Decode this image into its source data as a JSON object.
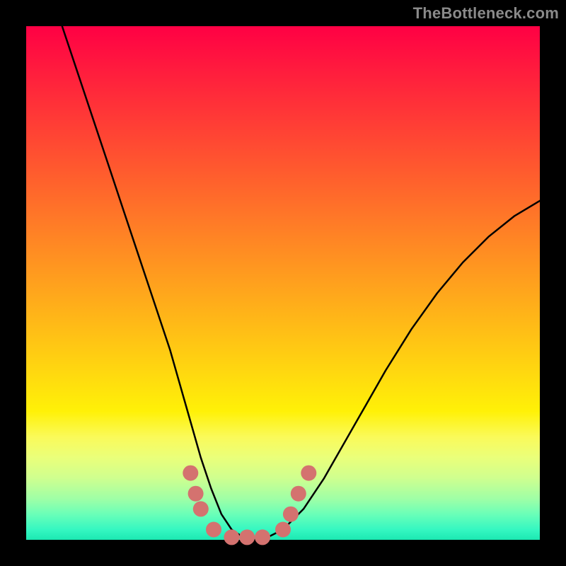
{
  "watermark": "TheBottleneck.com",
  "chart_data": {
    "type": "line",
    "title": "",
    "xlabel": "",
    "ylabel": "",
    "xlim": [
      0,
      100
    ],
    "ylim": [
      0,
      100
    ],
    "grid": false,
    "legend": false,
    "series": [
      {
        "name": "bottleneck-curve",
        "color": "#000000",
        "x": [
          7,
          10,
          13,
          16,
          19,
          22,
          25,
          28,
          30,
          32,
          34,
          36,
          38,
          40,
          43,
          46,
          50,
          54,
          58,
          62,
          66,
          70,
          75,
          80,
          85,
          90,
          95,
          100
        ],
        "y": [
          100,
          91,
          82,
          73,
          64,
          55,
          46,
          37,
          30,
          23,
          16,
          10,
          5,
          2,
          0,
          0,
          2,
          6,
          12,
          19,
          26,
          33,
          41,
          48,
          54,
          59,
          63,
          66
        ]
      }
    ],
    "markers": [
      {
        "name": "valley-markers",
        "color": "#d4726f",
        "radius_px": 11,
        "points": [
          {
            "x": 32,
            "y": 13
          },
          {
            "x": 33,
            "y": 9
          },
          {
            "x": 34,
            "y": 6
          },
          {
            "x": 36.5,
            "y": 2
          },
          {
            "x": 40,
            "y": 0.5
          },
          {
            "x": 43,
            "y": 0.5
          },
          {
            "x": 46,
            "y": 0.5
          },
          {
            "x": 50,
            "y": 2
          },
          {
            "x": 51.5,
            "y": 5
          },
          {
            "x": 53,
            "y": 9
          },
          {
            "x": 55,
            "y": 13
          }
        ]
      }
    ],
    "background_gradient": {
      "top": "#ff0044",
      "middle": "#ffcf10",
      "bottom": "#1ce8b2"
    }
  }
}
